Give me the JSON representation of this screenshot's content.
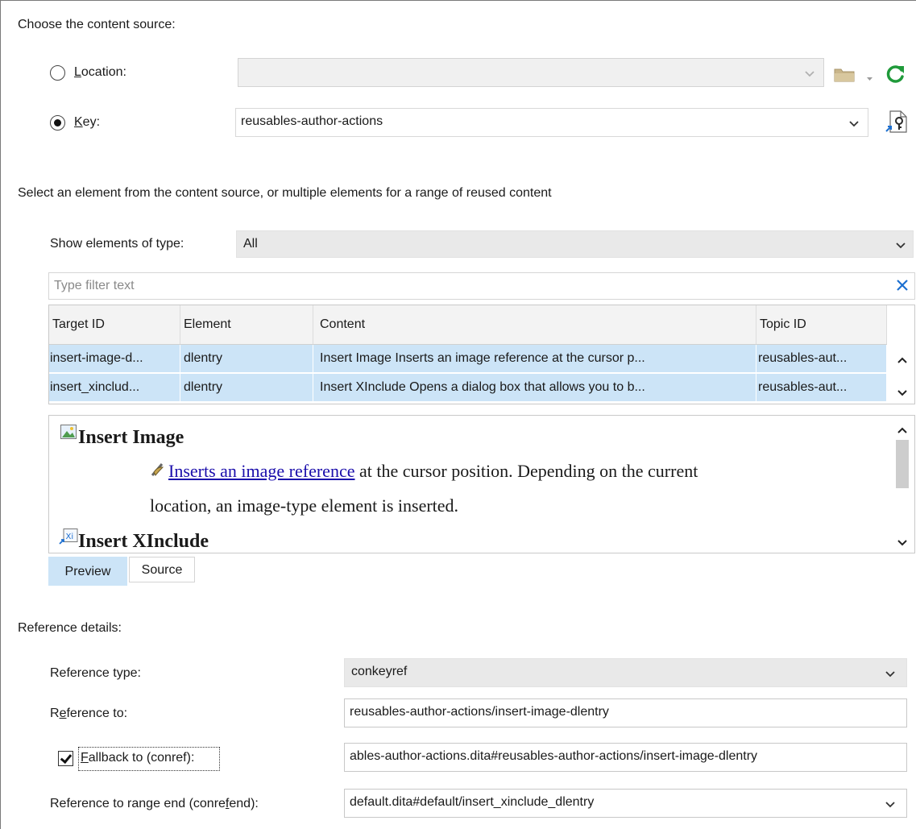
{
  "content_source": {
    "heading": "Choose the content source:",
    "location_label": "Location:",
    "location_value": "",
    "key_label": "Key:",
    "key_value": "reusables-author-actions"
  },
  "element_selection": {
    "instruction": "Select an element from the content source, or multiple elements for a range of reused content",
    "show_type_label": "Show elements of type:",
    "show_type_value": "All",
    "filter_placeholder": "Type filter text",
    "table": {
      "columns": [
        "Target ID",
        "Element",
        "Content",
        "Topic ID"
      ],
      "rows": [
        [
          "insert-image-d...",
          "dlentry",
          "Insert Image Inserts an image reference at the cursor p...",
          "reusables-aut..."
        ],
        [
          "insert_xinclud...",
          "dlentry",
          "Insert XInclude Opens a dialog box that allows you to b...",
          "reusables-aut..."
        ]
      ]
    }
  },
  "preview": {
    "item1_title": "Insert Image",
    "item1_link": "Inserts an image reference",
    "item1_text_a": " at the cursor position. Depending on the current",
    "item1_text_b": "location, an image-type element is inserted.",
    "item2_title": "Insert XInclude",
    "item2_icon_text": "Xi",
    "tabs": [
      "Preview",
      "Source"
    ]
  },
  "reference_details": {
    "heading": "Reference details:",
    "type_label": "Reference type:",
    "type_value": "conkeyref",
    "ref_to_label": "Reference to:",
    "ref_to_value": "reusables-author-actions/insert-image-dlentry",
    "fallback_label": "Fallback to  (conref):",
    "fallback_checked": true,
    "fallback_value": "ables-author-actions.dita#reusables-author-actions/insert-image-dlentry",
    "range_end_label": "Reference to range end  (conrefend):",
    "range_end_value": "default.dita#default/insert_xinclude_dlentry"
  },
  "colors": {
    "selection": "#cce4f7",
    "refresh_green": "#1f9a3a",
    "clear_blue": "#1c6fd0",
    "link": "#1a0dab"
  }
}
